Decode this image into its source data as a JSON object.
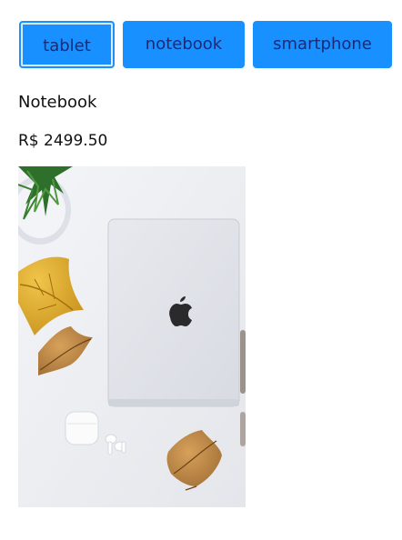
{
  "tabs": [
    {
      "label": "tablet",
      "active": true
    },
    {
      "label": "notebook",
      "active": false
    },
    {
      "label": "smartphone",
      "active": false
    }
  ],
  "product": {
    "name": "Notebook",
    "price": "R$ 2499.50",
    "image": "laptop on white desk with plant, dry leaves and earbuds"
  },
  "colors": {
    "button_bg": "#1890ff",
    "button_text": "#1b2b76",
    "text": "#111111",
    "background": "#ffffff"
  }
}
